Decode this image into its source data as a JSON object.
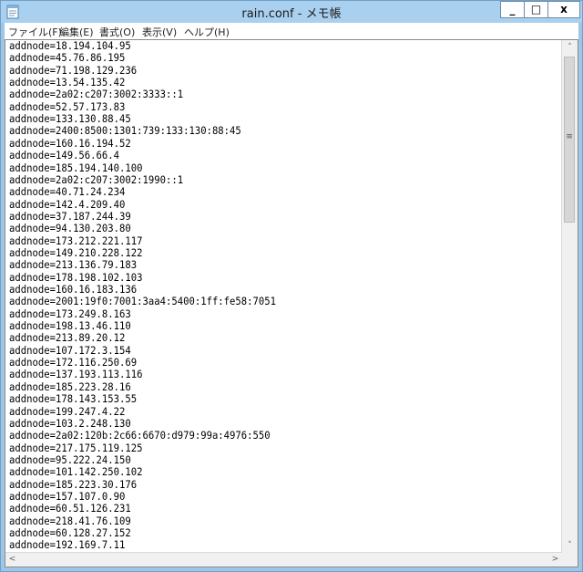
{
  "window": {
    "title": "rain.conf - メモ帳",
    "icon": "notepad-icon",
    "controls": {
      "minimize": "_",
      "maximize": "□",
      "close": "x"
    }
  },
  "menu": [
    {
      "label": "ファイル(F)"
    },
    {
      "label": "編集(E)"
    },
    {
      "label": "書式(O)"
    },
    {
      "label": "表示(V)"
    },
    {
      "label": "ヘルプ(H)"
    }
  ],
  "document": {
    "lines": [
      "addnode=18.194.104.95",
      "addnode=45.76.86.195",
      "addnode=71.198.129.236",
      "addnode=13.54.135.42",
      "addnode=2a02:c207:3002:3333::1",
      "addnode=52.57.173.83",
      "addnode=133.130.88.45",
      "addnode=2400:8500:1301:739:133:130:88:45",
      "addnode=160.16.194.52",
      "addnode=149.56.66.4",
      "addnode=185.194.140.100",
      "addnode=2a02:c207:3002:1990::1",
      "addnode=40.71.24.234",
      "addnode=142.4.209.40",
      "addnode=37.187.244.39",
      "addnode=94.130.203.80",
      "addnode=173.212.221.117",
      "addnode=149.210.228.122",
      "addnode=213.136.79.183",
      "addnode=178.198.102.103",
      "addnode=160.16.183.136",
      "addnode=2001:19f0:7001:3aa4:5400:1ff:fe58:7051",
      "addnode=173.249.8.163",
      "addnode=198.13.46.110",
      "addnode=213.89.20.12",
      "addnode=107.172.3.154",
      "addnode=172.116.250.69",
      "addnode=137.193.113.116",
      "addnode=185.223.28.16",
      "addnode=178.143.153.55",
      "addnode=199.247.4.22",
      "addnode=103.2.248.130",
      "addnode=2a02:120b:2c66:6670:d979:99a:4976:550",
      "addnode=217.175.119.125",
      "addnode=95.222.24.150",
      "addnode=101.142.250.102",
      "addnode=185.223.30.176",
      "addnode=157.107.0.90",
      "addnode=60.51.126.231",
      "addnode=218.41.76.109",
      "addnode=60.128.27.152",
      "addnode=192.169.7.11"
    ]
  },
  "scrollbar": {
    "up_arrow": "˄",
    "down_arrow": "˅",
    "left_arrow": "<",
    "right_arrow": ">",
    "grip": "≡"
  }
}
